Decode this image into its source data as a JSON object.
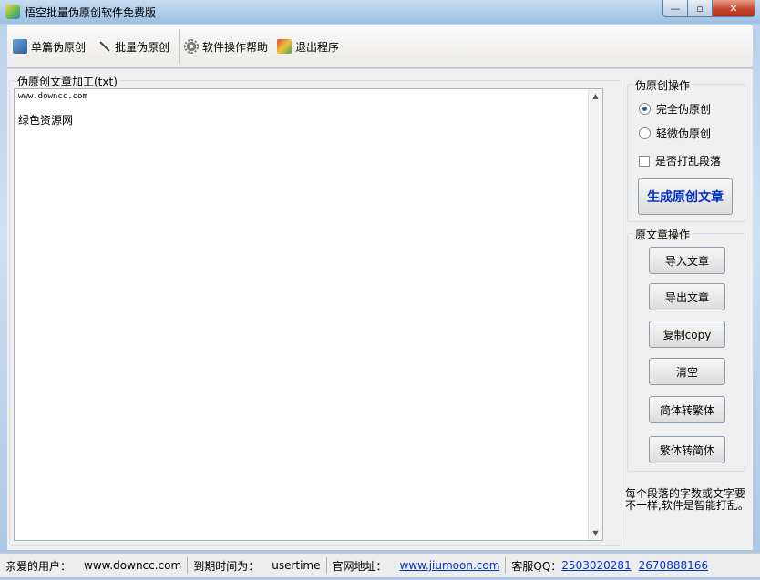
{
  "window": {
    "title": "悟空批量伪原创软件免费版"
  },
  "toolbar": {
    "items": [
      {
        "label": "单篇伪原创",
        "icon": "single-article-icon"
      },
      {
        "label": "批量伪原创",
        "icon": "batch-icon"
      },
      {
        "label": "软件操作帮助",
        "icon": "gear-icon"
      },
      {
        "label": "退出程序",
        "icon": "exit-icon"
      }
    ]
  },
  "editor": {
    "group_title": "伪原创文章加工(txt)",
    "lines": [
      "www.downcc.com",
      "绿色资源网"
    ]
  },
  "pseudo_ops": {
    "group_title": "伪原创操作",
    "radio_full": "完全伪原创",
    "radio_light": "轻微伪原创",
    "checkbox_shuffle": "是否打乱段落",
    "generate_button": "生成原创文章"
  },
  "source_ops": {
    "group_title": "原文章操作",
    "buttons": [
      "导入文章",
      "导出文章",
      "复制copy",
      "清空",
      "简体转繁体",
      "繁体转简体"
    ]
  },
  "note": "每个段落的字数或文字要不一样,软件是智能打乱。",
  "statusbar": {
    "user_label": "亲爱的用户：",
    "user_value": "www.downcc.com",
    "expire_label": "到期时间为：",
    "expire_value": "usertime",
    "site_label": "官网地址：",
    "site_link": "www.jiumoon.com",
    "qq_label": "客服QQ：",
    "qq1": "2503020281",
    "qq2": "2670888166"
  },
  "colors": {
    "link": "#0033cc",
    "generate_text": "#0033cc",
    "close_button": "#c4462e"
  }
}
